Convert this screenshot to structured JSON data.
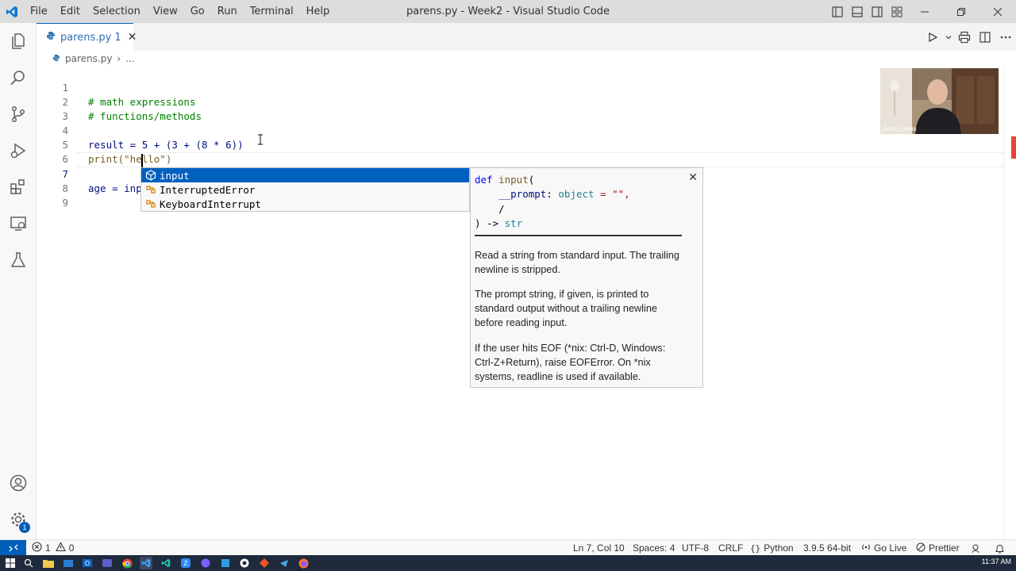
{
  "window": {
    "title": "parens.py - Week2 - Visual Studio Code",
    "menu": [
      "File",
      "Edit",
      "Selection",
      "View",
      "Go",
      "Run",
      "Terminal",
      "Help"
    ]
  },
  "tab": {
    "label": "parens.py",
    "problems": "1",
    "close": "✕"
  },
  "breadcrumb": {
    "file": "parens.py",
    "separator": "›",
    "more": "..."
  },
  "editor": {
    "lines": [
      {
        "num": "1",
        "text": "# math expressions"
      },
      {
        "num": "2",
        "text": "# functions/methods"
      },
      {
        "num": "3",
        "text": ""
      },
      {
        "num": "4",
        "text": "result = 5 + (3 + (8 * 6))"
      },
      {
        "num": "5",
        "text": "print(\"hello\")"
      },
      {
        "num": "6",
        "text": ""
      },
      {
        "num": "7",
        "text": "age = inp"
      },
      {
        "num": "8",
        "text": ""
      },
      {
        "num": "9",
        "text": ""
      }
    ]
  },
  "suggest": {
    "items": [
      "input",
      "InterruptedError",
      "KeyboardInterrupt"
    ]
  },
  "details": {
    "close": "✕",
    "signature": {
      "l1_kw": "def",
      "l1_fn": "input",
      "l1_paren": "(",
      "l2_param": "__prompt",
      "l2_colon": ":",
      "l2_type": "object",
      "l2_rest": " = \"\",",
      "l3": "/",
      "l4_a": ") -> ",
      "l4_type": "str"
    },
    "doc": [
      "Read a string from standard input. The trailing newline is stripped.",
      "The prompt string, if given, is printed to standard output without a trailing newline before reading input.",
      "If the user hits EOF (*nix: Ctrl-D, Windows: Ctrl-Z+Return), raise EOFError. On *nix systems, readline is used if available."
    ]
  },
  "webcam": {
    "name": "Justin Lewis"
  },
  "activity_badge": "1",
  "status": {
    "errors": "1",
    "warnings": "0",
    "position": "Ln 7, Col 10",
    "spaces": "Spaces: 4",
    "encoding": "UTF-8",
    "eol": "CRLF",
    "language": "Python",
    "interpreter": "3.9.5 64-bit",
    "live": "Go Live",
    "prettier": "Prettier"
  },
  "taskbar": {
    "clock": "11:37 AM"
  },
  "colors": {
    "accent": "#005fb8",
    "suggest_selected": "#0060c0",
    "comment": "#008000"
  }
}
